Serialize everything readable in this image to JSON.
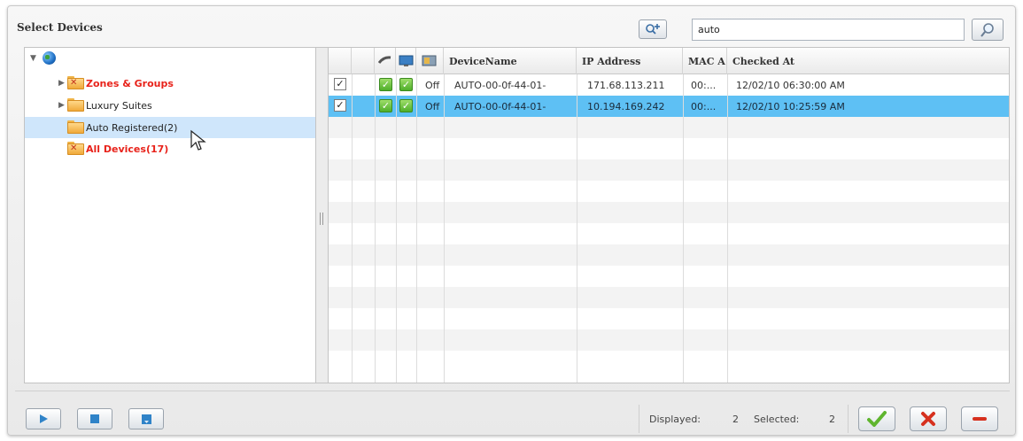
{
  "dialog": {
    "title": "Select Devices"
  },
  "search": {
    "value": "auto"
  },
  "tree": {
    "items": [
      {
        "label": "Zones & Groups"
      },
      {
        "label": "Luxury Suites"
      },
      {
        "label": "Auto Registered(2)"
      },
      {
        "label": "All Devices(17)"
      }
    ]
  },
  "grid": {
    "headers": {
      "device_name": "DeviceName",
      "ip": "IP Address",
      "mac": "MAC A",
      "checked_at": "Checked At"
    },
    "rows": [
      {
        "checked": true,
        "power": "Off",
        "device_name": "AUTO-00-0f-44-01-",
        "ip": "171.68.113.211",
        "mac": "00:...",
        "checked_at": "12/02/10 06:30:00 AM"
      },
      {
        "checked": true,
        "power": "Off",
        "device_name": "AUTO-00-0f-44-01-",
        "ip": "10.194.169.242",
        "mac": "00:...",
        "checked_at": "12/02/10 10:25:59 AM"
      }
    ]
  },
  "footer": {
    "displayed_label": "Displayed:",
    "displayed_value": "2",
    "selected_label": "Selected:",
    "selected_value": "2"
  },
  "colors": {
    "selected_row": "#5ec0f4",
    "selected_tree": "#cfe6fb",
    "red_label": "#e8231b",
    "accent_green": "#4fae2a"
  },
  "icons": [
    "globe-icon",
    "folder-icon",
    "add-device-icon",
    "search-icon",
    "play-icon",
    "stop-icon",
    "save-icon",
    "confirm-icon",
    "close-icon",
    "minus-icon"
  ]
}
